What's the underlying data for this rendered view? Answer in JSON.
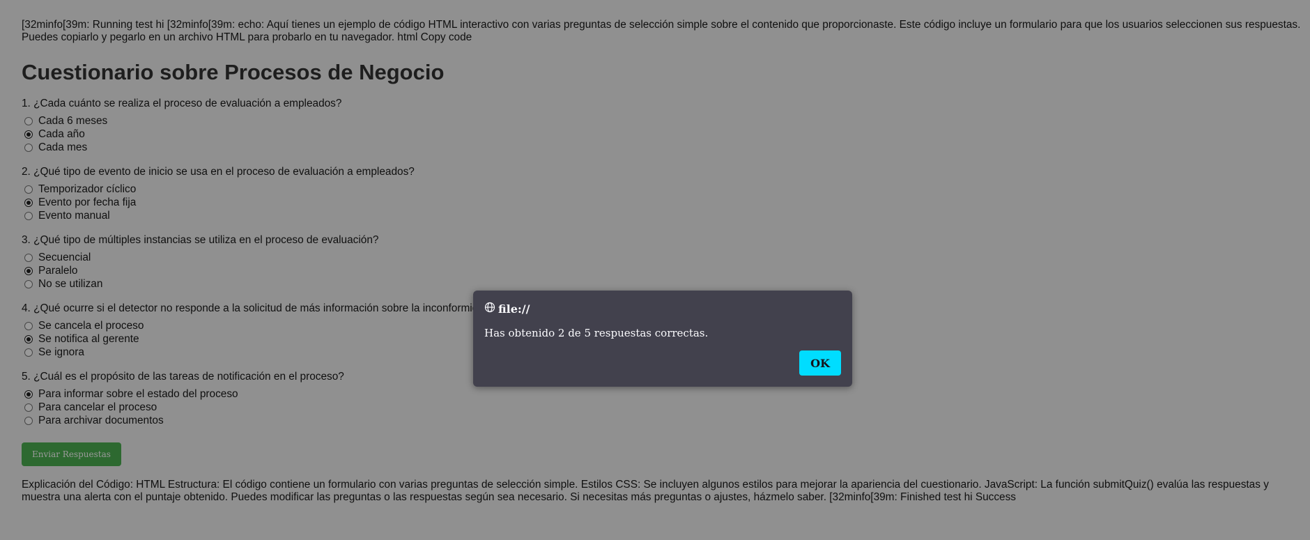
{
  "intro": "[32minfo[39m: Running test hi [32minfo[39m: echo: Aquí tienes un ejemplo de código HTML interactivo con varias preguntas de selección simple sobre el contenido que proporcionaste. Este código incluye un formulario para que los usuarios seleccionen sus respuestas. Puedes copiarlo y pegarlo en un archivo HTML para probarlo en tu navegador. html Copy code",
  "title": "Cuestionario sobre Procesos de Negocio",
  "questions": [
    {
      "text": "1. ¿Cada cuánto se realiza el proceso de evaluación a empleados?",
      "options": [
        "Cada 6 meses",
        "Cada año",
        "Cada mes"
      ],
      "selected": 1
    },
    {
      "text": "2. ¿Qué tipo de evento de inicio se usa en el proceso de evaluación a empleados?",
      "options": [
        "Temporizador cíclico",
        "Evento por fecha fija",
        "Evento manual"
      ],
      "selected": 1
    },
    {
      "text": "3. ¿Qué tipo de múltiples instancias se utiliza en el proceso de evaluación?",
      "options": [
        "Secuencial",
        "Paralelo",
        "No se utilizan"
      ],
      "selected": 1
    },
    {
      "text": "4. ¿Qué ocurre si el detector no responde a la solicitud de más información sobre la inconformidad?",
      "options": [
        "Se cancela el proceso",
        "Se notifica al gerente",
        "Se ignora"
      ],
      "selected": 1
    },
    {
      "text": "5. ¿Cuál es el propósito de las tareas de notificación en el proceso?",
      "options": [
        "Para informar sobre el estado del proceso",
        "Para cancelar el proceso",
        "Para archivar documentos"
      ],
      "selected": 0
    }
  ],
  "submit_label": "Enviar Respuestas",
  "explanation": "Explicación del Código: HTML Estructura: El código contiene un formulario con varias preguntas de selección simple. Estilos CSS: Se incluyen algunos estilos para mejorar la apariencia del cuestionario. JavaScript: La función submitQuiz() evalúa las respuestas y muestra una alerta con el puntaje obtenido. Puedes modificar las preguntas o las respuestas según sea necesario. Si necesitas más preguntas o ajustes, házmelo saber. [32minfo[39m: Finished test hi Success",
  "dialog": {
    "title": "file://",
    "message": "Has obtenido 2 de 5 respuestas correctas.",
    "ok_label": "OK",
    "icon": "globe-icon"
  },
  "colors": {
    "submit_button": "#4caf50",
    "dialog_bg": "#42414d",
    "ok_button": "#00ddff",
    "overlay": "rgba(0,0,0,0.4)"
  }
}
